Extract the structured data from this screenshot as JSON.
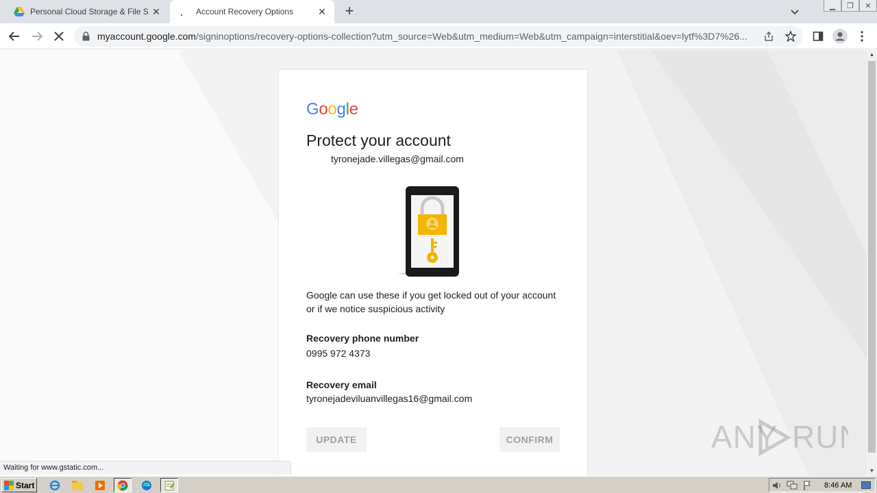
{
  "browser": {
    "tabs": [
      {
        "title": "Personal Cloud Storage & File Sharing",
        "active": false
      },
      {
        "title": "Account Recovery Options",
        "active": true
      }
    ],
    "address": {
      "domain": "myaccount.google.com",
      "path": "/signinoptions/recovery-options-collection?utm_source=Web&utm_medium=Web&utm_campaign=interstitial&oev=lytf%3D7%26..."
    },
    "status_text": "Waiting for www.gstatic.com..."
  },
  "page": {
    "logo": [
      "G",
      "o",
      "o",
      "g",
      "l",
      "e"
    ],
    "logo_colors": [
      "#4285F4",
      "#EA4335",
      "#FBBC05",
      "#4285F4",
      "#34A853",
      "#EA4335"
    ],
    "heading": "Protect your account",
    "account_email": "tyronejade.villegas@gmail.com",
    "description": "Google can use these if you get locked out of your account or if we notice suspicious activity",
    "recovery_phone_label": "Recovery phone number",
    "recovery_phone_value": "0995 972 4373",
    "recovery_email_label": "Recovery email",
    "recovery_email_value": "tyronejadeviluanvillegas16@gmail.com",
    "update_button": "UPDATE",
    "confirm_button": "CONFIRM"
  },
  "watermark": "ANY RUN",
  "taskbar": {
    "start_label": "Start",
    "clock": "8:46 AM"
  },
  "colors": {
    "lock_yellow": "#F4B400",
    "phone_black": "#1a1a1a"
  }
}
